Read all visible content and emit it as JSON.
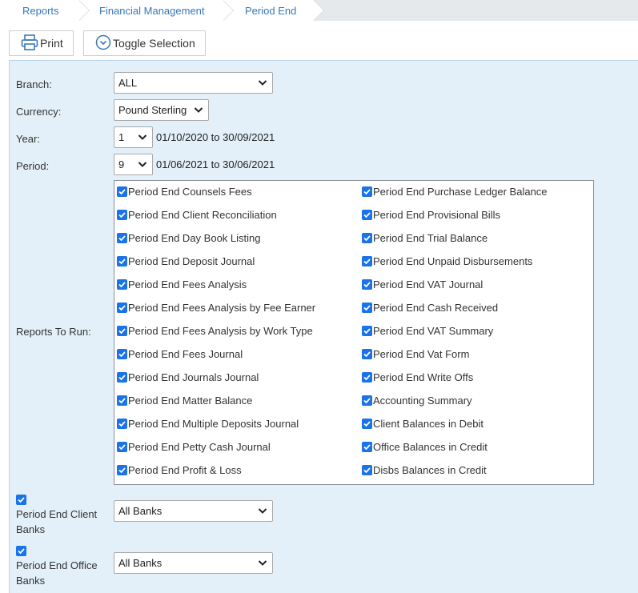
{
  "breadcrumb": [
    "Reports",
    "Financial Management",
    "Period End"
  ],
  "toolbar": {
    "print_label": "Print",
    "toggle_label": "Toggle Selection"
  },
  "form": {
    "branch": {
      "label": "Branch:",
      "value": "ALL"
    },
    "currency": {
      "label": "Currency:",
      "value": "Pound Sterling"
    },
    "year": {
      "label": "Year:",
      "value": "1",
      "range": "01/10/2020 to 30/09/2021"
    },
    "period": {
      "label": "Period:",
      "value": "9",
      "range": "01/06/2021 to 30/06/2021"
    },
    "reports_label": "Reports To Run:"
  },
  "reports_left": [
    "Period End Counsels Fees",
    "Period End Client Reconciliation",
    "Period End Day Book Listing",
    "Period End Deposit Journal",
    "Period End Fees Analysis",
    "Period End Fees Analysis by Fee Earner",
    "Period End Fees Analysis by Work Type",
    "Period End Fees Journal",
    "Period End Journals Journal",
    "Period End Matter Balance",
    "Period End Multiple Deposits Journal",
    "Period End Petty Cash Journal",
    "Period End Profit & Loss"
  ],
  "reports_right": [
    "Period End Purchase Ledger Balance",
    "Period End Provisional Bills",
    "Period End Trial Balance",
    "Period End Unpaid Disbursements",
    "Period End VAT Journal",
    "Period End Cash Received",
    "Period End VAT Summary",
    "Period End Vat Form",
    "Period End Write Offs",
    "Accounting Summary",
    "Client Balances in Debit",
    "Office Balances in Credit",
    "Disbs Balances in Credit"
  ],
  "client_banks": {
    "label": "Period End Client Banks",
    "value": "All Banks"
  },
  "office_banks": {
    "label": "Period End Office Banks",
    "value": "All Banks"
  },
  "colors": {
    "link": "#3a77b6",
    "panel": "#e3f0f9",
    "checkbox": "#1a73e8"
  }
}
